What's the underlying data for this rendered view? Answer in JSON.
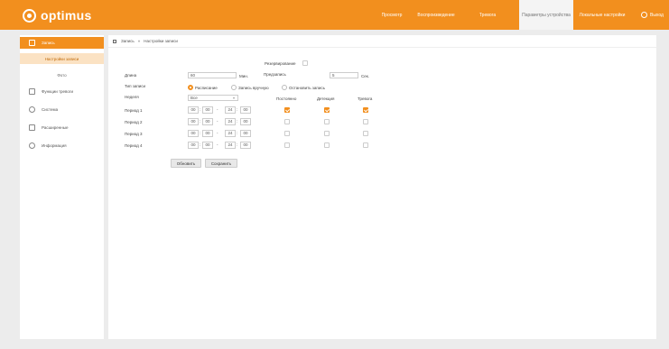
{
  "brand": {
    "name": "optimus"
  },
  "topnav": {
    "items": [
      {
        "label": "Просмотр"
      },
      {
        "label": "Воспроизведение"
      },
      {
        "label": "Тревога"
      },
      {
        "label": "Параметры устройства",
        "active": true
      },
      {
        "label": "Локальные настройки"
      }
    ],
    "logout": "Выход"
  },
  "sidebar": {
    "items": [
      {
        "label": "Запись",
        "active": true
      },
      {
        "label": "Настройки записи",
        "sub": true,
        "active": true
      },
      {
        "label": "Фото",
        "sub": true
      },
      {
        "label": "Функции тревоги"
      },
      {
        "label": "Система"
      },
      {
        "label": "Расширенные"
      },
      {
        "label": "Информация"
      }
    ]
  },
  "breadcrumb": {
    "section": "Запись",
    "separator": "»",
    "page": "Настройки записи"
  },
  "form": {
    "reserve_label": "Резервирование",
    "reserve_checked": false,
    "length_label": "Длина",
    "length_value": "60",
    "length_unit": "Мин.",
    "prerecord_label": "Предзапись",
    "prerecord_value": "5",
    "prerecord_unit": "Сек.",
    "type_label": "Тип записи",
    "type_options": [
      {
        "label": "Расписание",
        "selected": true
      },
      {
        "label": "Запись вручную",
        "selected": false
      },
      {
        "label": "Остановить запись",
        "selected": false
      }
    ],
    "week_label": "Неделя",
    "week_value": "Все",
    "col_headers": [
      "Постоянно",
      "Детекция",
      "Тревога"
    ],
    "periods": [
      {
        "label": "Период 1",
        "from_h": "00",
        "from_m": "00",
        "to_h": "24",
        "to_m": "00",
        "checks": [
          true,
          true,
          true
        ]
      },
      {
        "label": "Период 2",
        "from_h": "00",
        "from_m": "00",
        "to_h": "24",
        "to_m": "00",
        "checks": [
          false,
          false,
          false
        ]
      },
      {
        "label": "Период 3",
        "from_h": "00",
        "from_m": "00",
        "to_h": "24",
        "to_m": "00",
        "checks": [
          false,
          false,
          false
        ]
      },
      {
        "label": "Период 4",
        "from_h": "00",
        "from_m": "00",
        "to_h": "24",
        "to_m": "00",
        "checks": [
          false,
          false,
          false
        ]
      }
    ],
    "range_sep": "-",
    "time_sep": ":",
    "refresh_label": "Обновить",
    "save_label": "Сохранить"
  },
  "colors": {
    "accent": "#f28f1e",
    "background": "#ececec",
    "panel": "#ffffff"
  }
}
